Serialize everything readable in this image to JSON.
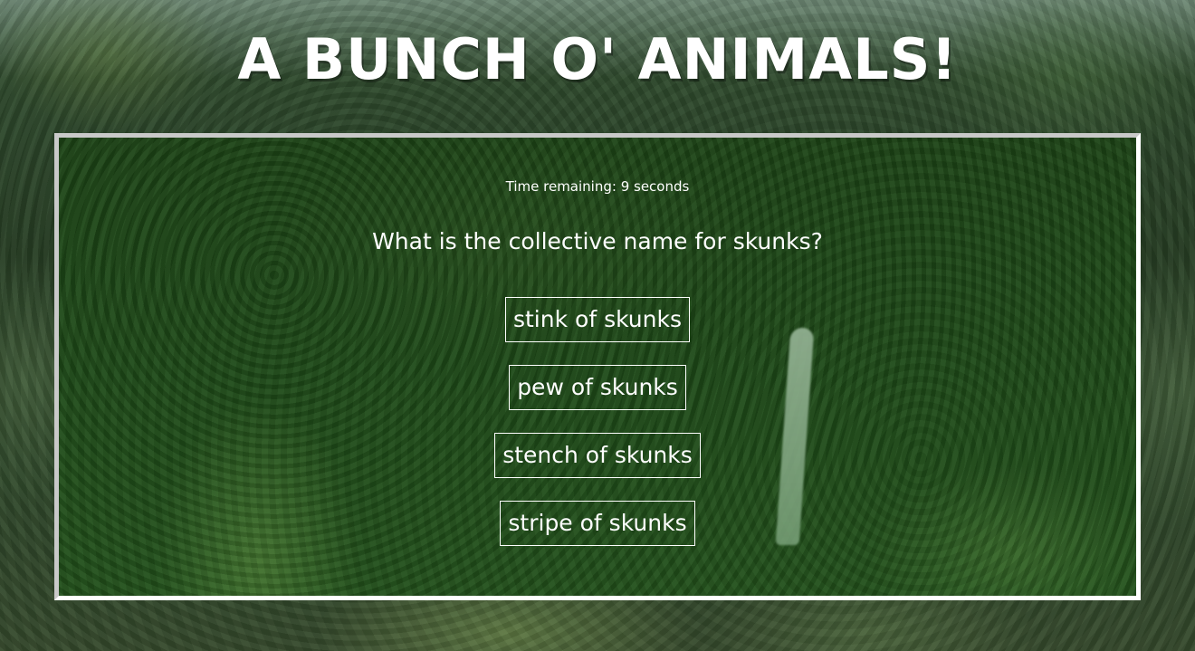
{
  "header": {
    "title": "A BUNCH O' ANIMALS!"
  },
  "quiz": {
    "timer_text": "Time remaining: 9 seconds",
    "question": "What is the collective name for skunks?",
    "answers": [
      "stink of skunks",
      "pew of skunks",
      "stench of skunks",
      "stripe of skunks"
    ]
  }
}
